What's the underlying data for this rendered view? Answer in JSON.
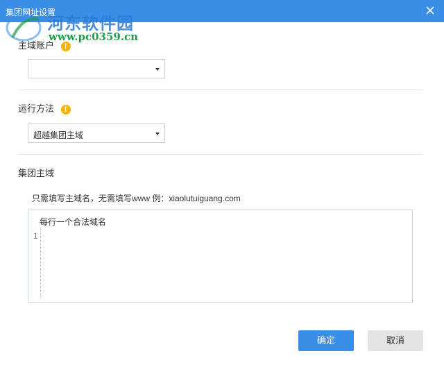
{
  "dialog": {
    "title": "集团网址设置"
  },
  "watermark": {
    "line1": "河东软件园",
    "line2": "www.pc0359.cn"
  },
  "fields": {
    "main_account": {
      "label": "主域账户",
      "value": ""
    },
    "run_method": {
      "label": "运行方法",
      "value": "超越集团主域"
    },
    "group_domain": {
      "label": "集团主域",
      "hint": "只需填写主域名，无需填写www  例：xiaolutuiguang.com",
      "placeholder": "每行一个合法域名",
      "line_number": "1"
    }
  },
  "buttons": {
    "ok": "确定",
    "cancel": "取消"
  },
  "colors": {
    "accent": "#3a8ee6",
    "warning": "#f5b400",
    "line_number": "#c8632a"
  }
}
